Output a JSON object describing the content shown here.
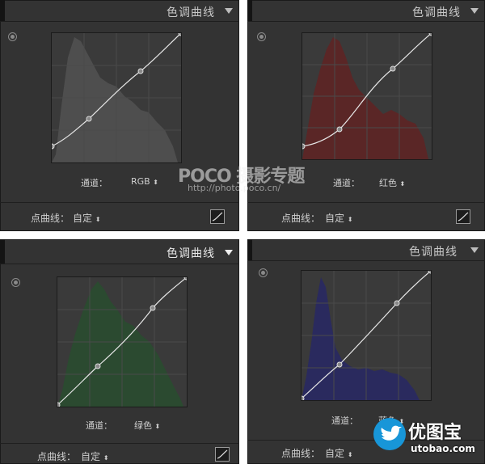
{
  "panels": [
    {
      "id": "rgb",
      "title": "色调曲线",
      "channel_label": "通道：",
      "channel_value": "RGB",
      "pointcurve_label": "点曲线：",
      "pointcurve_value": "自定",
      "histogram_color": "#5a5a5a",
      "icons": [
        "target-adjust-icon",
        "collapse-arrow-icon",
        "point-curve-edit-icon"
      ]
    },
    {
      "id": "red",
      "title": "色调曲线",
      "channel_label": "通道：",
      "channel_value": "红色",
      "pointcurve_label": "点曲线：",
      "pointcurve_value": "自定",
      "histogram_color": "#6b2a2a",
      "icons": [
        "target-adjust-icon",
        "collapse-arrow-icon",
        "point-curve-edit-icon"
      ]
    },
    {
      "id": "green",
      "title": "色调曲线",
      "channel_label": "通道：",
      "channel_value": "绿色",
      "pointcurve_label": "点曲线：",
      "pointcurve_value": "自定",
      "histogram_color": "#2d5233",
      "icons": [
        "target-adjust-icon",
        "collapse-arrow-icon",
        "point-curve-edit-icon"
      ]
    },
    {
      "id": "blue",
      "title": "色调曲线",
      "channel_label": "通道：",
      "channel_value": "蓝色",
      "pointcurve_label": "点曲线：",
      "pointcurve_value": "自定",
      "histogram_color": "#2e2e68",
      "icons": [
        "target-adjust-icon",
        "collapse-arrow-icon",
        "point-curve-edit-icon"
      ]
    }
  ],
  "watermark": {
    "line1": "POCO 摄影专题",
    "line2": "http://photo.poco.cn/"
  },
  "logo": {
    "name": "优图宝",
    "url": "utobao.com"
  },
  "colors": {
    "panel_bg": "#333333",
    "curve_line": "#e6e6e6"
  }
}
